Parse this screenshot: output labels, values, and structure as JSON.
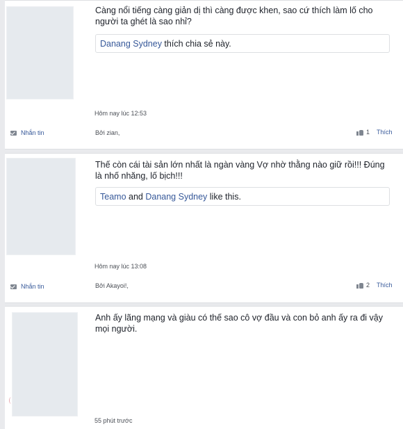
{
  "posts": [
    {
      "text": "Càng nổi tiếng càng giản dị thì càng được khen, sao cứ thích làm lố cho người ta ghét là sao nhỉ?",
      "likes": [
        {
          "name": "Danang Sydney",
          "link": true
        },
        {
          "name": " thích chia sẻ này.",
          "link": false
        }
      ],
      "time": "Hôm nay lúc 12:53",
      "byline": "Bởi zian,",
      "message_label": "Nhắn tin",
      "like_count": "1",
      "like_label": "Thích"
    },
    {
      "text": "Thế còn cái tài sản lớn nhất là ngàn vàng Vợ nhờ thằng nào giữ rồi!!! Đúng là nhố nhăng, lố bịch!!!",
      "likes": [
        {
          "name": "Teamo",
          "link": true
        },
        {
          "name": " and ",
          "link": false
        },
        {
          "name": "Danang Sydney",
          "link": true
        },
        {
          "name": " like this.",
          "link": false
        }
      ],
      "time": "Hôm nay lúc 13:08",
      "byline": "Bởi Akayoi!,",
      "message_label": "Nhắn tin",
      "like_count": "2",
      "like_label": "Thích"
    },
    {
      "text": "Anh ấy lãng mạng và giàu có thế sao cô vợ đầu và con bỏ anh ấy ra đi vậy mọi người.",
      "time": "55 phút trước"
    }
  ]
}
